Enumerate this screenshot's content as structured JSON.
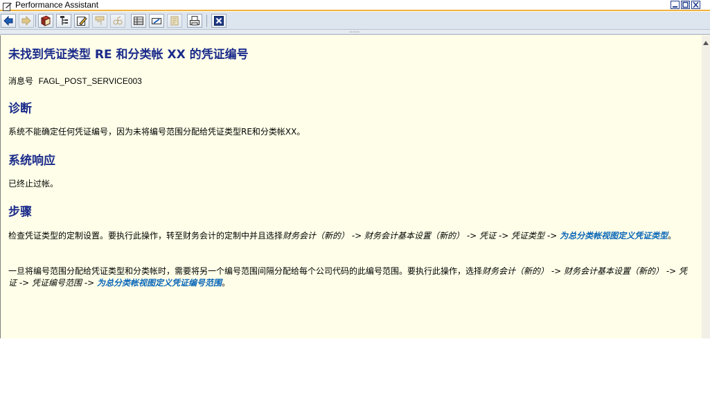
{
  "window": {
    "title": "Performance Assistant"
  },
  "toolbar": {
    "buttons": [
      {
        "icon": "back-arrow-icon"
      },
      {
        "icon": "forward-arrow-icon"
      },
      {
        "icon": "book-icon"
      },
      {
        "icon": "structure-icon"
      },
      {
        "icon": "edit-note-icon"
      },
      {
        "icon": "technical-info-icon"
      },
      {
        "icon": "glasses-icon"
      },
      {
        "icon": "table-icon"
      },
      {
        "icon": "pencil-box-icon"
      },
      {
        "icon": "note-icon"
      },
      {
        "icon": "print-icon"
      },
      {
        "icon": "close-icon"
      }
    ]
  },
  "doc": {
    "title": "未找到凭证类型  RE 和分类帐  XX 的凭证编号",
    "message_label": "消息号",
    "message_no": "FAGL_POST_SERVICE003",
    "sections": {
      "diagnosis": {
        "heading": "诊断",
        "text": "系统不能确定任何凭证编号，因为未将编号范围分配给凭证类型RE和分类帐XX。"
      },
      "response": {
        "heading": "系统响应",
        "text": "已终止过帐。"
      },
      "procedure": {
        "heading": "步骤",
        "p1_prefix": "检查凭证类型的定制设置。要执行此操作，转至财务会计的定制中并且选择",
        "p1_menu": "财务会计（新的） -> 财务会计基本设置（新的） -> 凭证 -> 凭证类型 -> ",
        "p1_link": "为总分类帐视图定义凭证类型",
        "p1_end": "。",
        "p2_prefix": "一旦将编号范围分配给凭证类型和分类帐时，需要将另一个编号范围间隔分配给每个公司代码的此编号范围。要执行此操作，选择",
        "p2_menu": "财务会计（新的） -> 财务会计基本设置（新的） -> 凭证 -> 凭证编号范围 -> ",
        "p2_link": "为总分类帐视图定义凭证编号范围",
        "p2_end": "。"
      }
    }
  },
  "colors": {
    "heading": "#1a2a8a",
    "link": "#0a66b8",
    "background": "#ffffe9",
    "title_accent": "#f0b040"
  }
}
